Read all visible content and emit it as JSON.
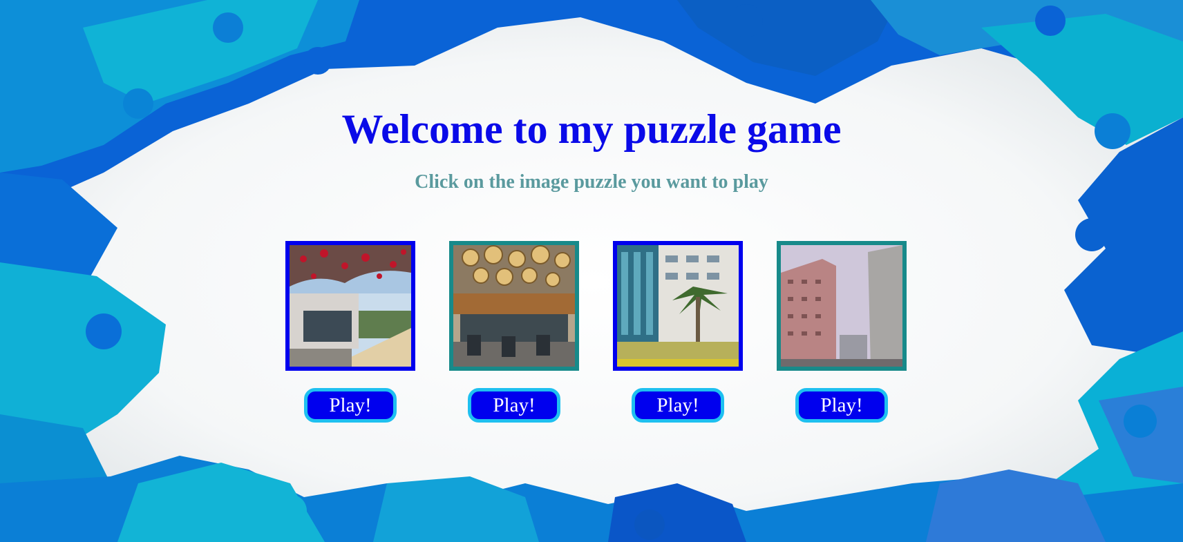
{
  "page": {
    "title": "Welcome to my puzzle game",
    "subtitle": "Click on the image puzzle you want to play"
  },
  "colors": {
    "title": "#0a0ae8",
    "subtitle": "#5a9a9e",
    "button_fill": "#0000ee",
    "button_border": "#1ec0f0",
    "frame_blue": "#0000ee",
    "frame_teal": "#178a8a"
  },
  "puzzles": [
    {
      "image": "campus-building-with-red-blossoms",
      "frame": "frame_blue",
      "button_label": "Play!"
    },
    {
      "image": "cafeteria-interior-with-hanging-lamps",
      "frame": "frame_teal",
      "button_label": "Play!"
    },
    {
      "image": "glass-building-with-palm-trees",
      "frame": "frame_blue",
      "button_label": "Play!"
    },
    {
      "image": "tall-pink-apartment-buildings",
      "frame": "frame_teal",
      "button_label": "Play!"
    }
  ]
}
